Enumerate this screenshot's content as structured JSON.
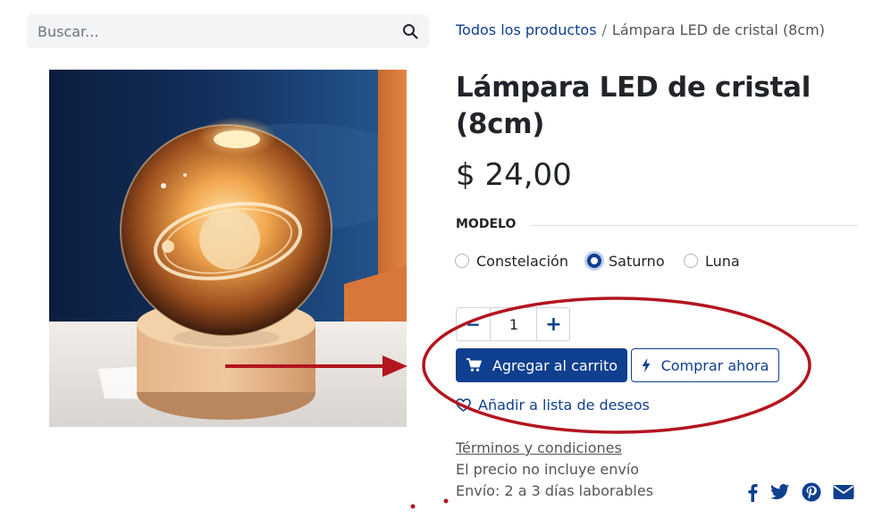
{
  "search": {
    "placeholder": "Buscar..."
  },
  "breadcrumb": {
    "parent": "Todos los productos",
    "separator": "/",
    "current": "Lámpara LED de cristal (8cm)"
  },
  "product": {
    "title": "Lámpara LED de cristal (8cm)",
    "price": "$ 24,00",
    "attribute": {
      "name": "MODELO",
      "options": [
        {
          "label": "Constelación",
          "selected": false
        },
        {
          "label": "Saturno",
          "selected": true
        },
        {
          "label": "Luna",
          "selected": false
        }
      ]
    },
    "quantity": {
      "minus": "−",
      "value": "1",
      "plus": "+"
    },
    "add_to_cart": "Agregar al carrito",
    "buy_now": "Comprar ahora",
    "wishlist": "Añadir a lista de deseos",
    "terms": "Términos y condiciones",
    "notes": [
      "El precio no incluye envío",
      "Envío: 2 a 3 días laborables"
    ]
  },
  "share_icons": [
    "facebook-icon",
    "twitter-icon",
    "pinterest-icon",
    "email-icon"
  ],
  "colors": {
    "primary": "#0f3f8f",
    "annotation": "#b3151f"
  }
}
